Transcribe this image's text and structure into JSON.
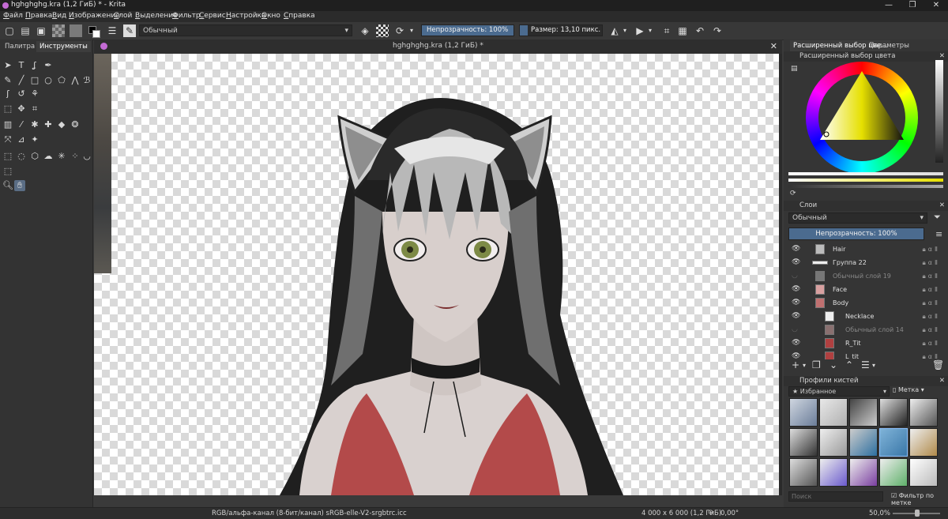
{
  "window": {
    "title": "hghghghg.kra (1,2 ГиБ) * - Krita"
  },
  "menu": [
    "Файл",
    "Правка",
    "Вид",
    "Изображение",
    "Слой",
    "Выделение",
    "Фильтр",
    "Сервис",
    "Настройка",
    "Окно",
    "Справка"
  ],
  "toolbar": {
    "blend_mode": "Обычный",
    "opacity_label": "Непрозрачность: 100%",
    "opacity_value": 1.0,
    "size_label": "Размер: 13,10 пикс.",
    "size_value": 0.1
  },
  "left_tabs": [
    "Палитра",
    "Инструменты"
  ],
  "document": {
    "tab_title": "hghghghg.kra (1,2 ГиБ) *"
  },
  "right_tabs": [
    "Расширенный выбор цве...",
    "Параметры инструмен..."
  ],
  "color_panel": {
    "title": "Расширенный выбор цвета"
  },
  "layers_panel": {
    "title": "Слои",
    "blend_mode": "Обычный",
    "opacity_label": "Непрозрачность:  100%",
    "layers": [
      {
        "name": "Hair",
        "visible": true
      },
      {
        "name": "Группа 22",
        "visible": true
      },
      {
        "name": "Обычный слой 19",
        "visible": false
      },
      {
        "name": "Face",
        "visible": true
      },
      {
        "name": "Body",
        "visible": true
      },
      {
        "name": "Necklace",
        "visible": true
      },
      {
        "name": "Обычный слой 14",
        "visible": false
      },
      {
        "name": "R_Tit",
        "visible": true
      },
      {
        "name": "L_tit",
        "visible": true
      }
    ]
  },
  "brush_panel": {
    "title": "Профили кистей",
    "favorites": "Избранное",
    "tag_label": "Метка",
    "search_placeholder": "Поиск",
    "filter_label": "Фильтр по метке"
  },
  "status": {
    "color_space": "RGB/альфа-канал (8-бит/канал)  sRGB-elle-V2-srgbtrc.icc",
    "dimensions": "4 000 x 6 000 (1,2 ГиБ)",
    "rotation": "0,00°",
    "zoom": "50,0%"
  }
}
